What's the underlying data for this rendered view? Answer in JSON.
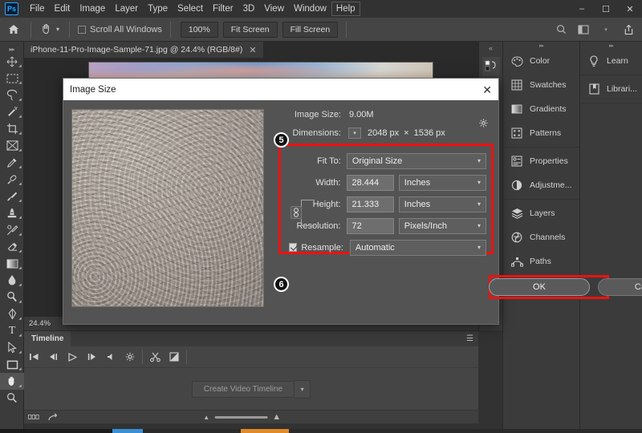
{
  "menubar": {
    "logo": "Ps",
    "items": [
      "File",
      "Edit",
      "Image",
      "Layer",
      "Type",
      "Select",
      "Filter",
      "3D",
      "View",
      "Window",
      "Help"
    ],
    "window_controls": [
      "minimize",
      "maximize",
      "close"
    ]
  },
  "optionsbar": {
    "home_icon": "home-icon",
    "tool_icon": "hand-tool-icon",
    "scroll_all_windows_label": "Scroll All Windows",
    "scroll_all_windows_checked": false,
    "buttons": [
      "100%",
      "Fit Screen",
      "Fill Screen"
    ],
    "right_icons": [
      "search-icon",
      "workspace-icon",
      "share-icon"
    ]
  },
  "toolbar": {
    "tools": [
      {
        "name": "move-tool"
      },
      {
        "name": "rectangular-marquee-tool"
      },
      {
        "name": "lasso-tool"
      },
      {
        "name": "magic-wand-tool"
      },
      {
        "name": "crop-tool"
      },
      {
        "name": "frame-tool"
      },
      {
        "name": "eyedropper-tool"
      },
      {
        "name": "spot-healing-brush-tool"
      },
      {
        "name": "brush-tool"
      },
      {
        "name": "clone-stamp-tool"
      },
      {
        "name": "history-brush-tool"
      },
      {
        "name": "eraser-tool"
      },
      {
        "name": "gradient-tool"
      },
      {
        "name": "blur-tool"
      },
      {
        "name": "dodge-tool"
      },
      {
        "name": "pen-tool"
      },
      {
        "name": "type-tool"
      },
      {
        "name": "path-selection-tool"
      },
      {
        "name": "rectangle-tool"
      },
      {
        "name": "hand-tool",
        "active": true
      },
      {
        "name": "zoom-tool"
      }
    ]
  },
  "document": {
    "tab_title": "iPhone-11-Pro-Image-Sample-71.jpg @ 24.4% (RGB/8#)",
    "zoom_level": "24.4%"
  },
  "panels": {
    "column1": [
      {
        "label": "Color",
        "icon": "color-icon"
      },
      {
        "label": "Swatches",
        "icon": "swatches-icon"
      },
      {
        "label": "Gradients",
        "icon": "gradients-icon"
      },
      {
        "label": "Patterns",
        "icon": "patterns-icon"
      },
      {
        "label": "Properties",
        "icon": "properties-icon"
      },
      {
        "label": "Adjustme...",
        "icon": "adjustments-icon"
      },
      {
        "label": "Layers",
        "icon": "layers-icon"
      },
      {
        "label": "Channels",
        "icon": "channels-icon"
      },
      {
        "label": "Paths",
        "icon": "paths-icon"
      }
    ],
    "column2": [
      {
        "label": "Learn",
        "icon": "learn-icon"
      },
      {
        "label": "Librari...",
        "icon": "libraries-icon"
      }
    ]
  },
  "timeline": {
    "tab_label": "Timeline",
    "create_button": "Create Video Timeline",
    "transport_icons": [
      "go-to-first-frame-icon",
      "previous-frame-icon",
      "play-icon",
      "next-frame-icon",
      "audio-icon",
      "settings-gear-icon",
      "split-at-playhead-icon",
      "transition-icon"
    ]
  },
  "dialog": {
    "title": "Image Size",
    "close_icon": "close-icon",
    "image_size_label": "Image Size:",
    "image_size_value": "9.00M",
    "gear_icon": "gear-icon",
    "dimensions_label": "Dimensions:",
    "dimensions_width": "2048 px",
    "dimensions_separator": "×",
    "dimensions_height": "1536 px",
    "fit_to_label": "Fit To:",
    "fit_to_value": "Original Size",
    "width_label": "Width:",
    "width_value": "28.444",
    "width_unit": "Inches",
    "height_label": "Height:",
    "height_value": "21.333",
    "height_unit": "Inches",
    "resolution_label": "Resolution:",
    "resolution_value": "72",
    "resolution_unit": "Pixels/Inch",
    "resample_label": "Resample:",
    "resample_value": "Automatic",
    "resample_checked": true,
    "chain_icon": "link-constrain-icon",
    "ok_button": "OK",
    "cancel_button": "Cancel"
  },
  "annotations": {
    "badge_fields": "5",
    "badge_ok": "6",
    "highlight_color": "#ee1111"
  }
}
